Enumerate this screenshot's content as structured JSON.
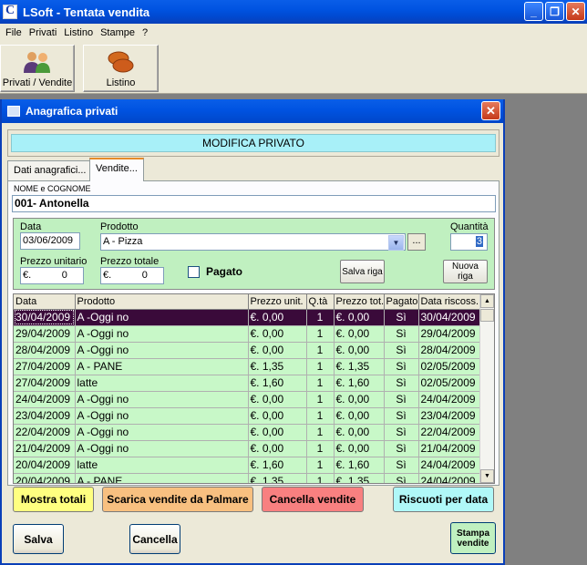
{
  "window": {
    "title": "LSoft - Tentata vendita"
  },
  "menu": [
    "File",
    "Privati",
    "Listino",
    "Stampe",
    "?"
  ],
  "toolbar": {
    "privati_label": "Privati / Vendite",
    "listino_label": "Listino"
  },
  "dialog": {
    "title": "Anagrafica privati",
    "banner": "MODIFICA PRIVATO",
    "tabs": [
      "Dati anagrafici...",
      "Vendite..."
    ],
    "nome_label": "NOME e COGNOME",
    "nome_value": "001- Antonella"
  },
  "form": {
    "data_label": "Data",
    "data_value": "03/06/2009",
    "prodotto_label": "Prodotto",
    "prodotto_value": "A - Pizza",
    "ellipsis": "...",
    "quantita_label": "Quantità",
    "quantita_value": "3",
    "prezzo_unit_label": "Prezzo unitario",
    "prezzo_unit_value": "€.           0",
    "prezzo_tot_label": "Prezzo totale",
    "prezzo_tot_value": "€.           0",
    "pagato_label": "Pagato",
    "salva_riga": "Salva riga",
    "nuova_riga": "Nuova riga"
  },
  "table": {
    "columns": [
      "Data",
      "Prodotto",
      "Prezzo unit.",
      "Q.tà",
      "Prezzo tot.",
      "Pagato",
      "Data riscoss."
    ],
    "rows": [
      [
        "30/04/2009",
        "A -Oggi no",
        "€. 0,00",
        "1",
        "€. 0,00",
        "Sì",
        "30/04/2009"
      ],
      [
        "29/04/2009",
        "A -Oggi no",
        "€. 0,00",
        "1",
        "€. 0,00",
        "Sì",
        "29/04/2009"
      ],
      [
        "28/04/2009",
        "A -Oggi no",
        "€. 0,00",
        "1",
        "€. 0,00",
        "Sì",
        "28/04/2009"
      ],
      [
        "27/04/2009",
        "A - PANE",
        "€. 1,35",
        "1",
        "€. 1,35",
        "Sì",
        "02/05/2009"
      ],
      [
        "27/04/2009",
        "latte",
        "€. 1,60",
        "1",
        "€. 1,60",
        "Sì",
        "02/05/2009"
      ],
      [
        "24/04/2009",
        "A -Oggi no",
        "€. 0,00",
        "1",
        "€. 0,00",
        "Sì",
        "24/04/2009"
      ],
      [
        "23/04/2009",
        "A -Oggi no",
        "€. 0,00",
        "1",
        "€. 0,00",
        "Sì",
        "23/04/2009"
      ],
      [
        "22/04/2009",
        "A -Oggi no",
        "€. 0,00",
        "1",
        "€. 0,00",
        "Sì",
        "22/04/2009"
      ],
      [
        "21/04/2009",
        "A -Oggi no",
        "€. 0,00",
        "1",
        "€. 0,00",
        "Sì",
        "21/04/2009"
      ],
      [
        "20/04/2009",
        "latte",
        "€. 1,60",
        "1",
        "€. 1,60",
        "Sì",
        "24/04/2009"
      ],
      [
        "20/04/2009",
        "A - PANE",
        "€. 1,35",
        "1",
        "€. 1,35",
        "Sì",
        "24/04/2009"
      ]
    ]
  },
  "actions": {
    "mostra_totali": "Mostra totali",
    "scarica": "Scarica vendite da Palmare",
    "cancella_vendite": "Cancella vendite",
    "riscuoti": "Riscuoti per data",
    "salva": "Salva",
    "cancella": "Cancella",
    "stampa_vendite": "Stampa vendite"
  },
  "colors": {
    "titlebar": "#0053e1",
    "banner": "#a8f0f8",
    "form_bg": "#c0f0c0",
    "grid_bg": "#c8f8c8",
    "selected_row": "#3a0a3a",
    "mostra_totali": "#ffff80",
    "scarica": "#f8c080",
    "cancella_vendite": "#f88080",
    "riscuoti": "#b0f8f8",
    "stampa_vendite": "#c0f0c0"
  }
}
